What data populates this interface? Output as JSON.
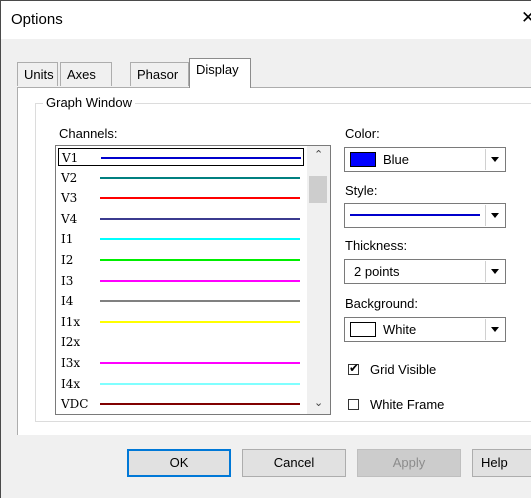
{
  "window": {
    "title": "Options",
    "close_glyph": "✕"
  },
  "tabs": [
    {
      "label": "Units",
      "active": false
    },
    {
      "label": "Axes",
      "active": false
    },
    {
      "label": "Phasor",
      "active": false
    },
    {
      "label": "Display",
      "active": true
    }
  ],
  "graph_window": {
    "group_label": "Graph Window",
    "channels_label": "Channels:",
    "channels": [
      {
        "name": "V1",
        "color": "#0000cc",
        "selected": true
      },
      {
        "name": "V2",
        "color": "#008080",
        "selected": false
      },
      {
        "name": "V3",
        "color": "#ff0000",
        "selected": false
      },
      {
        "name": "V4",
        "color": "#3b3b8f",
        "selected": false
      },
      {
        "name": "I1",
        "color": "#00ffff",
        "selected": false
      },
      {
        "name": "I2",
        "color": "#00ee00",
        "selected": false
      },
      {
        "name": "I3",
        "color": "#ff00ff",
        "selected": false
      },
      {
        "name": "I4",
        "color": "#808080",
        "selected": false
      },
      {
        "name": "I1x",
        "color": "#ffff00",
        "selected": false
      },
      {
        "name": "I2x",
        "color": "#ffffff",
        "selected": false
      },
      {
        "name": "I3x",
        "color": "#ff00ff",
        "selected": false
      },
      {
        "name": "I4x",
        "color": "#80ffff",
        "selected": false
      },
      {
        "name": "VDC",
        "color": "#800000",
        "selected": false
      }
    ],
    "color": {
      "label": "Color:",
      "value": "Blue",
      "swatch": "#0000ff"
    },
    "style": {
      "label": "Style:",
      "line_color": "#0000cc"
    },
    "thickness": {
      "label": "Thickness:",
      "value": "2 points"
    },
    "background": {
      "label": "Background:",
      "value": "White",
      "swatch": "#ffffff"
    },
    "grid_visible": {
      "label": "Grid Visible",
      "checked": true
    },
    "white_frame": {
      "label": "White Frame",
      "checked": false
    }
  },
  "buttons": {
    "ok": "OK",
    "cancel": "Cancel",
    "apply": "Apply",
    "help": "Help"
  }
}
